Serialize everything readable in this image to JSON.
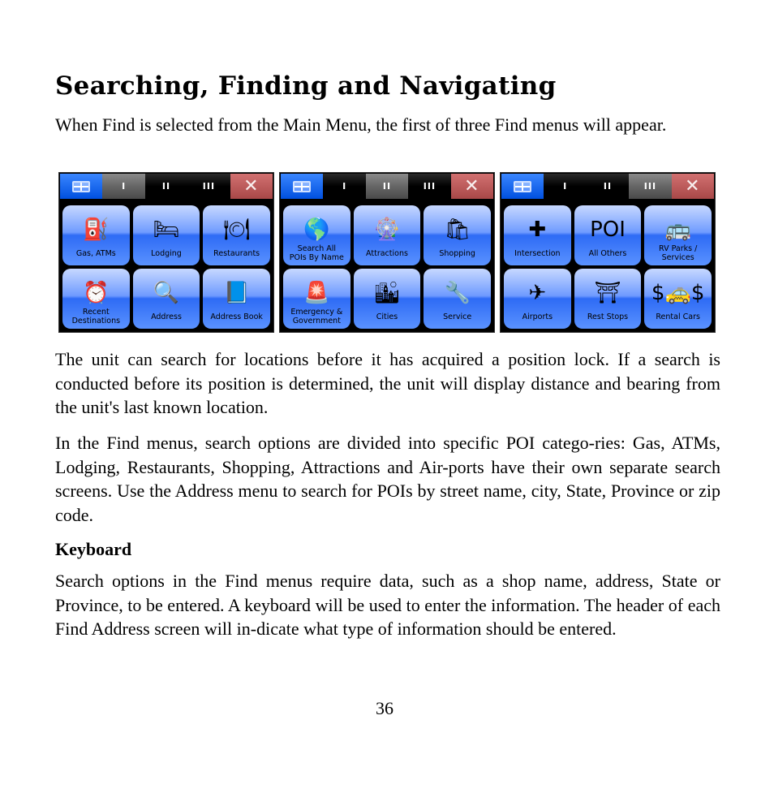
{
  "heading": "Searching, Finding and Navigating",
  "intro": "When Find is selected from the Main Menu, the first of three Find menus will appear.",
  "screens": [
    {
      "tabs": {
        "menu_icon": "grid-menu-icon",
        "tab1": "I",
        "tab2": "II",
        "tab3": "III",
        "close_icon": "close-icon",
        "active": 1
      },
      "buttons": [
        {
          "label": "Gas, ATMs",
          "icon": "gas-pump-icon",
          "glyph": "⛽"
        },
        {
          "label": "Lodging",
          "icon": "bed-icon",
          "glyph": "🛏"
        },
        {
          "label": "Restaurants",
          "icon": "plate-cutlery-icon",
          "glyph": "🍽"
        },
        {
          "label": "Recent\nDestinations",
          "icon": "clock-magnifier-icon",
          "glyph": "⏰"
        },
        {
          "label": "Address",
          "icon": "envelope-magnifier-icon",
          "glyph": "🔍"
        },
        {
          "label": "Address Book",
          "icon": "address-book-icon",
          "glyph": "📘"
        }
      ]
    },
    {
      "tabs": {
        "menu_icon": "grid-menu-icon",
        "tab1": "I",
        "tab2": "II",
        "tab3": "III",
        "close_icon": "close-icon",
        "active": 2
      },
      "buttons": [
        {
          "label": "Search All\nPOIs By Name",
          "icon": "globe-icon",
          "glyph": "🌎"
        },
        {
          "label": "Attractions",
          "icon": "ferris-wheel-icon",
          "glyph": "🎡"
        },
        {
          "label": "Shopping",
          "icon": "shopping-bags-icon",
          "glyph": "🛍"
        },
        {
          "label": "Emergency &\nGovernment",
          "icon": "emergency-light-icon",
          "glyph": "🚨"
        },
        {
          "label": "Cities",
          "icon": "city-buildings-icon",
          "glyph": "🏙"
        },
        {
          "label": "Service",
          "icon": "wrench-icon",
          "glyph": "🔧"
        }
      ]
    },
    {
      "tabs": {
        "menu_icon": "grid-menu-icon",
        "tab1": "I",
        "tab2": "II",
        "tab3": "III",
        "close_icon": "close-icon",
        "active": 3
      },
      "buttons": [
        {
          "label": "Intersection",
          "icon": "intersection-icon",
          "glyph": "✚"
        },
        {
          "label": "All Others",
          "icon": "poi-magnifier-icon",
          "glyph": "POI"
        },
        {
          "label": "RV Parks /\nServices",
          "icon": "rv-icon",
          "glyph": "🚌"
        },
        {
          "label": "Airports",
          "icon": "airplane-icon",
          "glyph": "✈"
        },
        {
          "label": "Rest Stops",
          "icon": "picnic-table-icon",
          "glyph": "⛩"
        },
        {
          "label": "Rental Cars",
          "icon": "car-dollar-icon",
          "glyph": "$🚕$"
        }
      ]
    }
  ],
  "para2": "The unit can search for locations before it has acquired a position lock. If a search is conducted before its position is determined, the unit will display distance and bearing from the unit's last known location.",
  "para3": "In the Find menus, search options are divided into specific POI catego-ries: Gas, ATMs, Lodging, Restaurants, Shopping, Attractions and Air-ports have their own separate search screens. Use the Address menu to search for POIs by street name, city, State, Province or zip code.",
  "subheading": "Keyboard",
  "para4": "Search options in the Find menus require data, such as a shop name, address, State or Province, to be entered. A keyboard will be used to enter the information. The header of each Find Address screen will in-dicate what type of information should be entered.",
  "page_number": "36"
}
